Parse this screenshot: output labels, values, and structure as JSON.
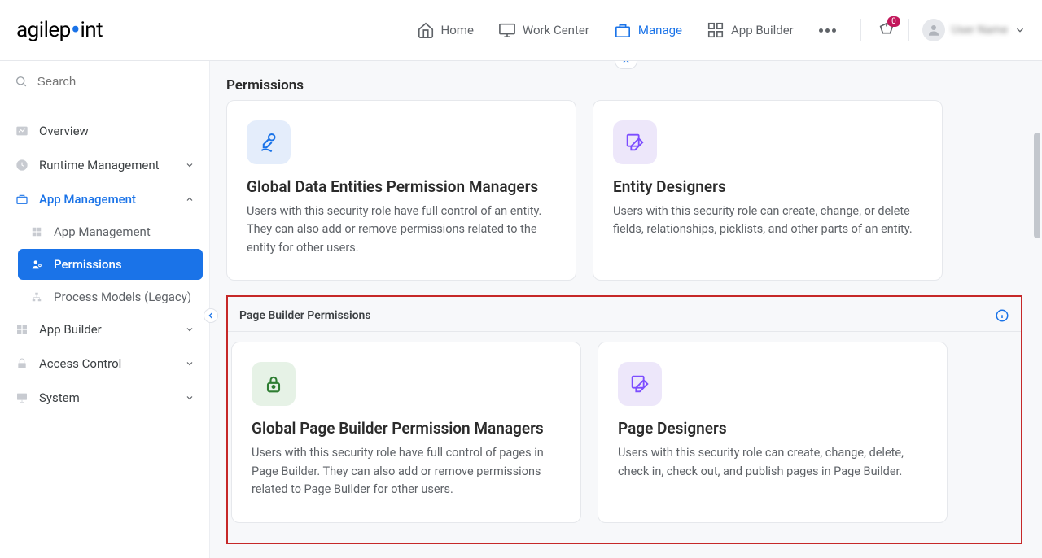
{
  "header": {
    "logo_text_1": "agilep",
    "logo_text_2": "int",
    "nav": {
      "home": "Home",
      "work_center": "Work Center",
      "manage": "Manage",
      "app_builder": "App Builder"
    },
    "badge_count": "0",
    "username": "User Name"
  },
  "sidebar": {
    "search_placeholder": "Search",
    "items": {
      "overview": "Overview",
      "runtime_management": "Runtime Management",
      "app_management": "App Management",
      "app_management_sub": "App Management",
      "permissions": "Permissions",
      "process_models": "Process Models (Legacy)",
      "app_builder": "App Builder",
      "access_control": "Access Control",
      "system": "System"
    }
  },
  "main": {
    "page_title": "Permissions",
    "top_cards": {
      "global_data_entities": {
        "title": "Global Data Entities Permission Managers",
        "desc": "Users with this security role have full control of an entity. They can also add or remove permissions related to the entity for other users."
      },
      "entity_designers": {
        "title": "Entity Designers",
        "desc": "Users with this security role can create, change, or delete fields, relationships, picklists, and other parts of an entity."
      }
    },
    "page_builder_section": {
      "label": "Page Builder Permissions",
      "global_managers": {
        "title": "Global Page Builder Permission Managers",
        "desc": "Users with this security role have full control of pages in Page Builder. They can also add or remove permissions related to Page Builder for other users."
      },
      "page_designers": {
        "title": "Page Designers",
        "desc": "Users with this security role can create, change, delete, check in, check out, and publish pages in Page Builder."
      }
    }
  }
}
